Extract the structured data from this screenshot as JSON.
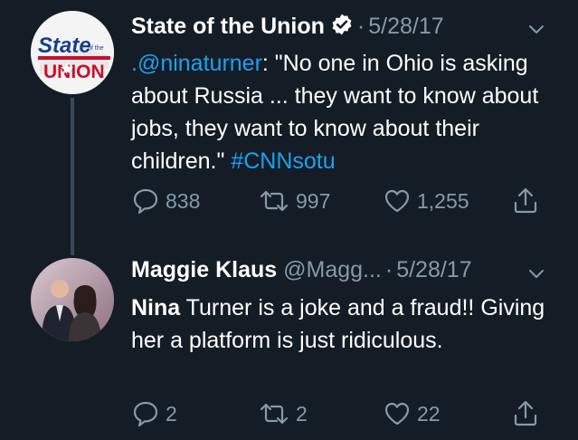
{
  "tweets": [
    {
      "author_name": "State of the Union",
      "date": "5/28/17",
      "body": {
        "mention": ".@ninaturner",
        "text": ": \"No one in Ohio is asking about Russia ... they want to know about jobs, they want to know about their children.\" ",
        "hashtag": "#CNNsotu"
      },
      "counts": {
        "replies": "838",
        "retweets": "997",
        "likes": "1,255"
      },
      "avatar_logo": {
        "line1": "State",
        "small": "of the",
        "line2": "UNION"
      }
    },
    {
      "author_name": "Maggie Klaus",
      "handle": "@Magg...",
      "date": "5/28/17",
      "body": {
        "bold": "Nina",
        "text": " Turner is a joke and a fraud!! Giving her a platform is just ridiculous."
      },
      "counts": {
        "replies": "2",
        "retweets": "2",
        "likes": "22"
      }
    }
  ],
  "colors": {
    "background": "#141d26",
    "link": "#1da1f2",
    "muted": "#8899a6",
    "text": "#ffffff"
  },
  "icons": [
    "verified-icon",
    "chevron-down-icon",
    "reply-icon",
    "retweet-icon",
    "like-icon",
    "share-icon"
  ]
}
